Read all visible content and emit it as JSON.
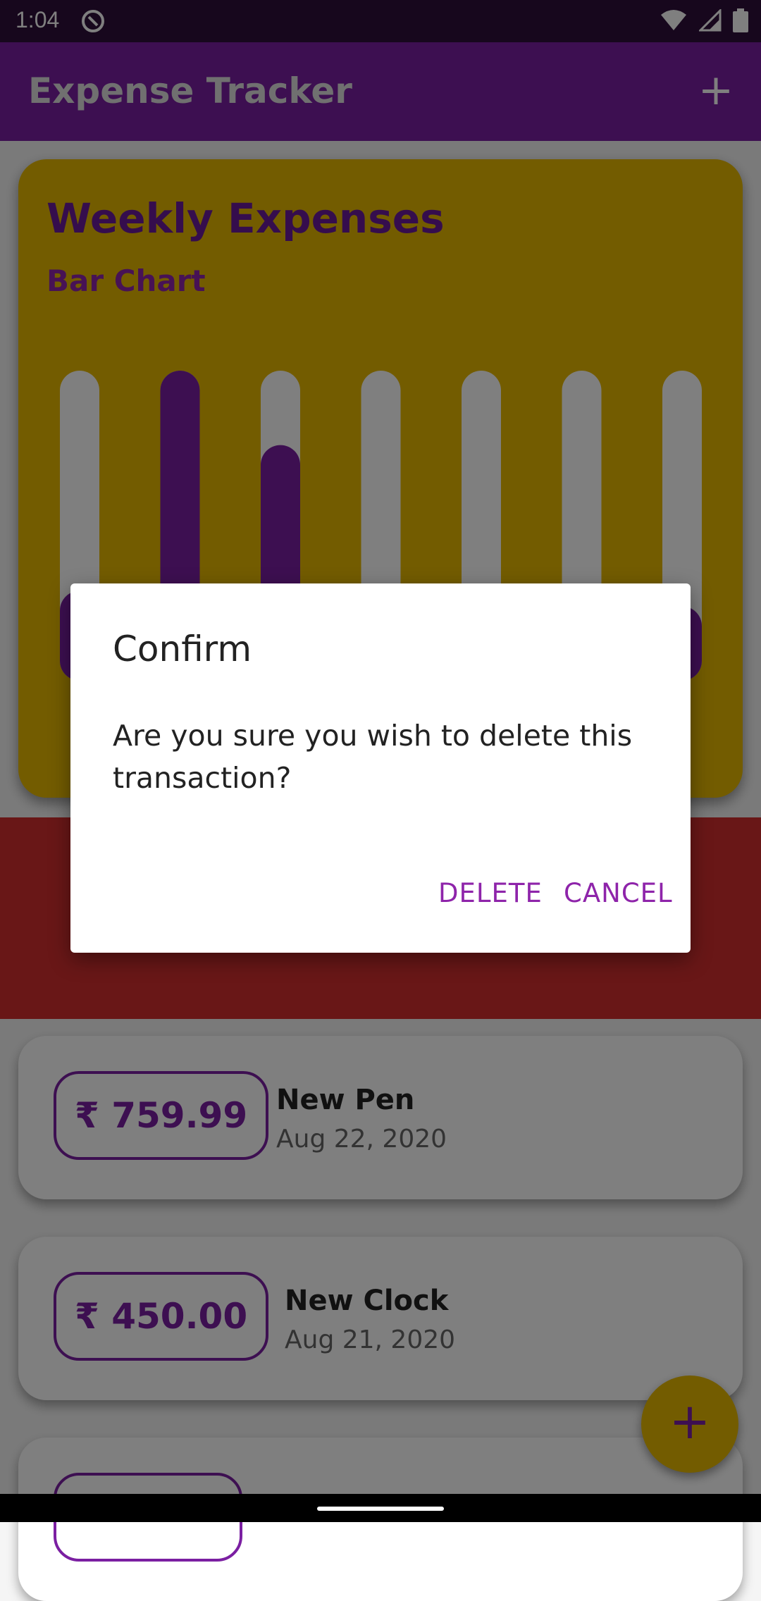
{
  "status_bar": {
    "time": "1:04",
    "icons": [
      "app-notification-icon",
      "wifi-icon",
      "signal-icon",
      "battery-icon"
    ]
  },
  "app_bar": {
    "title": "Expense Tracker",
    "add_label": "+"
  },
  "chart_card": {
    "title": "Weekly Expenses",
    "subtitle": "Bar Chart"
  },
  "chart_data": {
    "type": "bar",
    "categories": [
      "",
      "",
      "",
      "",
      "",
      "",
      ""
    ],
    "values": [
      0.29,
      1.0,
      0.76,
      0.24,
      0.0,
      0.0,
      0.24
    ],
    "ylim": [
      0,
      1
    ],
    "colors": {
      "fill": "#7b1fa2",
      "track": "#ffffff"
    }
  },
  "dialog": {
    "title": "Confirm",
    "message": "Are you sure you wish to delete this transaction?",
    "delete_label": "DELETE",
    "cancel_label": "CANCEL"
  },
  "transactions": [
    {
      "amount": "₹ 759.99",
      "title": "New Pen",
      "date": "Aug 22, 2020"
    },
    {
      "amount": "₹ 450.00",
      "title": "New Clock",
      "date": "Aug 21, 2020"
    }
  ],
  "fab": {
    "label": "+"
  },
  "colors": {
    "primary": "#7b1fa2",
    "accent": "#e6b800",
    "danger": "#d32f2f"
  }
}
